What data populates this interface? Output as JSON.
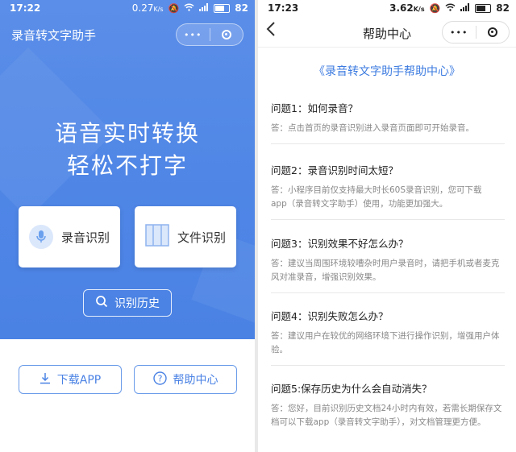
{
  "left": {
    "status": {
      "time": "17:22",
      "speed": "0.27",
      "speed_unit": "K/s",
      "battery": "82"
    },
    "app_title": "录音转文字助手",
    "capsule": {
      "more": "•••"
    },
    "slogan": [
      "语音实时转换",
      "轻松不打字"
    ],
    "cards": [
      {
        "label": "录音识别",
        "icon": "microphone-icon"
      },
      {
        "label": "文件识别",
        "icon": "file-columns-icon"
      }
    ],
    "history_label": "识别历史",
    "download_label": "下载APP",
    "help_label": "帮助中心",
    "colors": {
      "hero": "#4f86e6",
      "accent": "#4a82e4"
    }
  },
  "right": {
    "status": {
      "time": "17:23",
      "speed": "3.62",
      "speed_unit": "K/s",
      "battery": "82"
    },
    "nav_title": "帮助中心",
    "capsule": {
      "more": "•••"
    },
    "help_title": "《录音转文字助手帮助中心》",
    "faqs": [
      {
        "q": "问题1：如何录音？",
        "a": [
          "答：点击首页的录音识别进入录音页面即可开始录音。"
        ]
      },
      {
        "q": "问题2：录音识别时间太短？",
        "a": [
          "答：小程序目前仅支持最大时长60S录音识别，您可下载",
          "app（录音转文字助手）使用，功能更加强大。"
        ]
      },
      {
        "q": "问题3：识别效果不好怎么办？",
        "a": [
          "答：建议当周围环境较嘈杂时用户录音时，请把手机或者麦克",
          "风对准录音，增强识别效果。"
        ]
      },
      {
        "q": "问题4：识别失败怎么办？",
        "a": [
          "答：建议用户在较优的网络环境下进行操作识别，增强用户体",
          "验。"
        ]
      },
      {
        "q": "问题5:保存历史为什么会自动消失？",
        "a": [
          "答：您好，目前识别历史文档24小时内有效，若需长期保存文",
          "档可以下载app（录音转文字助手），对文档管理更方便。"
        ]
      }
    ],
    "colors": {
      "title": "#3c7be0"
    }
  }
}
